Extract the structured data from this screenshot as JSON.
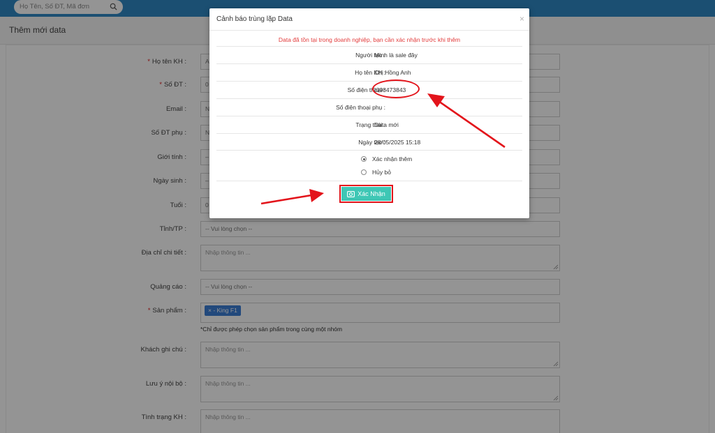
{
  "topbar": {
    "search_placeholder": "Họ Tên, Số ĐT, Mã đơn",
    "search_icon": "search-icon"
  },
  "page": {
    "title": "Thêm mới data"
  },
  "form": {
    "fields": [
      {
        "label": "Họ tên KH :",
        "required": true,
        "value": "A"
      },
      {
        "label": "Số ĐT :",
        "required": true,
        "value": "0"
      },
      {
        "label": "Email :",
        "required": false,
        "value": "N"
      },
      {
        "label": "Số ĐT phụ :",
        "required": false,
        "value": "N"
      },
      {
        "label": "Giới tính :",
        "required": false,
        "value": "–"
      },
      {
        "label": "Ngày sinh :",
        "required": false,
        "value": "–"
      },
      {
        "label": "Tuổi :",
        "required": false,
        "value": "0"
      },
      {
        "label": "Tỉnh/TP :",
        "required": false,
        "value": "-- Vui lòng chọn --"
      },
      {
        "label": "Địa chỉ chi tiết :",
        "required": false,
        "placeholder": "Nhập thông tin ..."
      },
      {
        "label": "Quảng cáo :",
        "required": false,
        "value": "-- Vui lòng chọn --"
      },
      {
        "label": "Sản phẩm :",
        "required": true,
        "tag": "× - King F1"
      },
      {
        "label": "Khách ghi chú :",
        "required": false,
        "placeholder": "Nhập thông tin ..."
      },
      {
        "label": "Lưu ý nội bộ :",
        "required": false,
        "placeholder": "Nhập thông tin ..."
      },
      {
        "label": "Tình trạng KH :",
        "required": false,
        "placeholder": "Nhập thông tin ..."
      }
    ],
    "product_hint": "*Chỉ được phép chọn sản phẩm trong cùng một nhóm"
  },
  "modal": {
    "title": "Cảnh báo trùng lặp Data",
    "close": "×",
    "warning": "Data đã tồn tại trong doanh nghiệp, bạn cần xác nhận trước khi thêm",
    "rows": [
      {
        "label": "Người tạo :",
        "value": "Mình là sale đây"
      },
      {
        "label": "Họ tên KH :",
        "value": "Chị Hồng Anh"
      },
      {
        "label": "Số điện thoại :",
        "value": "0398473843"
      },
      {
        "label": "Số điện thoại phụ :",
        "value": ""
      },
      {
        "label": "Trạng thái :",
        "value": "Data mới"
      },
      {
        "label": "Ngày tạo :",
        "value": "28/05/2025 15:18"
      }
    ],
    "options": [
      {
        "label": "Xác nhận thêm",
        "selected": true
      },
      {
        "label": "Hủy bỏ",
        "selected": false
      }
    ],
    "confirm_label": "Xác Nhận",
    "confirm_icon": "camera-icon"
  },
  "colors": {
    "topbar": "#2f88c4",
    "warning": "#e23b3b",
    "confirm": "#3ec7b5",
    "annotation": "#e3141b",
    "tag": "#3c7fd6"
  }
}
